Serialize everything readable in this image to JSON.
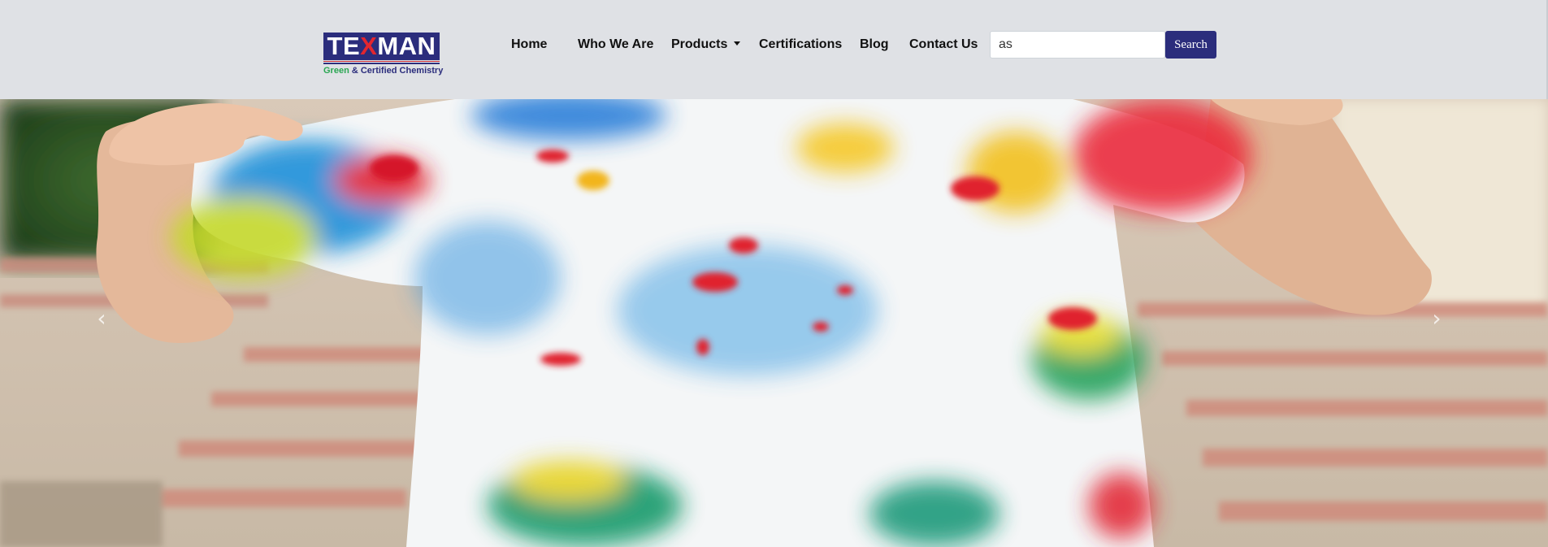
{
  "brand": {
    "logo_text_before": "TE",
    "logo_text_x": "X",
    "logo_text_after": "MAN",
    "tagline_green": "Green",
    "tagline_rest": " & Certified Chemistry",
    "colors": {
      "primary": "#2b2d7c",
      "accent_red": "#e3262f",
      "accent_green": "#2aa652"
    }
  },
  "nav": {
    "items": [
      {
        "label": "Home"
      },
      {
        "label": "Who We Are"
      },
      {
        "label": "Products",
        "has_dropdown": true
      },
      {
        "label": "Certifications"
      },
      {
        "label": "Blog"
      },
      {
        "label": "Contact Us"
      }
    ]
  },
  "search": {
    "value": "as",
    "button_label": "Search"
  },
  "hero": {
    "image_subject": "tie-dyed t-shirt held up by person",
    "prev_icon": "chevron-left-icon",
    "next_icon": "chevron-right-icon"
  }
}
